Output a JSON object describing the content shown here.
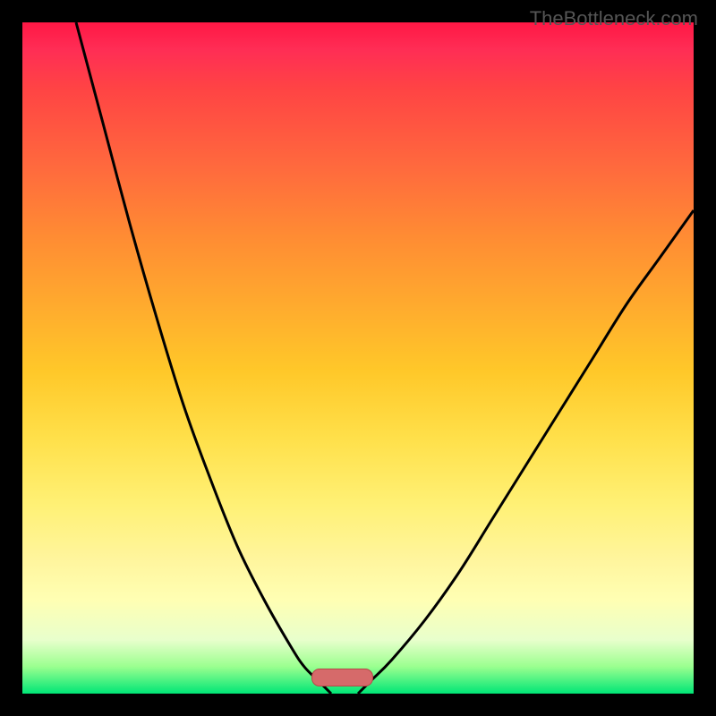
{
  "watermark": "TheBottleneck.com",
  "chart_data": {
    "type": "line",
    "title": "",
    "xlabel": "",
    "ylabel": "",
    "xlim": [
      0,
      100
    ],
    "ylim": [
      0,
      100
    ],
    "series": [
      {
        "name": "left-curve",
        "x": [
          8,
          12,
          16,
          20,
          24,
          28,
          32,
          36,
          40,
          42,
          44,
          46
        ],
        "values": [
          100,
          85,
          70,
          56,
          43,
          32,
          22,
          14,
          7,
          4,
          2,
          0
        ]
      },
      {
        "name": "right-curve",
        "x": [
          50,
          52,
          55,
          60,
          65,
          70,
          75,
          80,
          85,
          90,
          95,
          100
        ],
        "values": [
          0,
          2,
          5,
          11,
          18,
          26,
          34,
          42,
          50,
          58,
          65,
          72
        ]
      }
    ],
    "marker": {
      "name": "bottleneck-range",
      "x_start": 43,
      "x_end": 52,
      "color": "#d66a6a"
    },
    "gradient_colors": {
      "top": "#ff1744",
      "middle": "#ffe04a",
      "bottom": "#00e676"
    }
  }
}
